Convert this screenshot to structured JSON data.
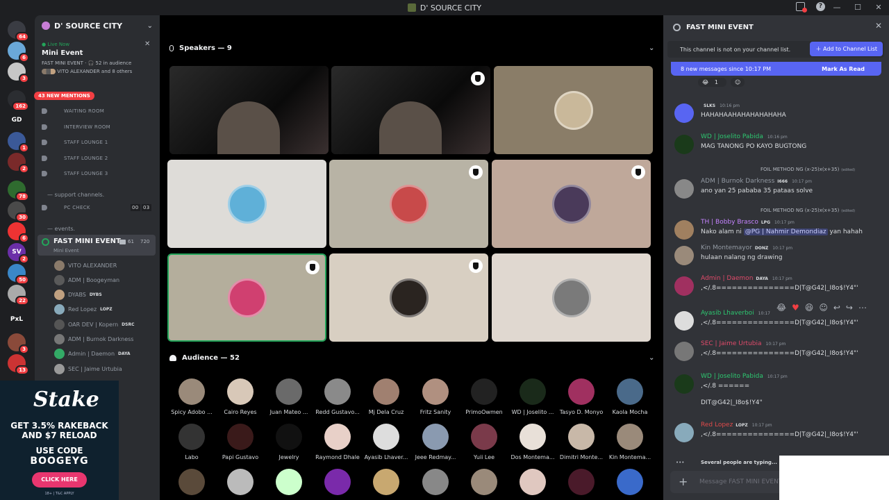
{
  "window": {
    "title": "D' SOURCE CITY"
  },
  "rail": {
    "servers": [
      {
        "label": "",
        "badge": "64",
        "color": "#3a3c43"
      },
      {
        "label": "",
        "badge": "6",
        "color": "#6aa8d8"
      },
      {
        "label": "",
        "badge": "3",
        "color": "#c7c7c7"
      },
      {
        "label": "",
        "badge": "162",
        "color": "#2b2d31"
      },
      {
        "label": "GD",
        "badge": "",
        "color": "#1e1f22"
      },
      {
        "label": "",
        "badge": "1",
        "color": "#3b5998"
      },
      {
        "label": "",
        "badge": "2",
        "color": "#7a2a2a"
      },
      {
        "label": "",
        "badge": "78",
        "color": "#2f6b2f"
      },
      {
        "label": "",
        "badge": "30",
        "color": "#4a4a4a"
      },
      {
        "label": "",
        "badge": "6",
        "color": "#e33"
      },
      {
        "label": "SV",
        "badge": "2",
        "color": "#6b2fa8"
      },
      {
        "label": "",
        "badge": "50",
        "color": "#3a87c8"
      },
      {
        "label": "",
        "badge": "22",
        "color": "#aaa"
      },
      {
        "label": "PxL",
        "badge": "",
        "color": "#1e1f22"
      },
      {
        "label": "",
        "badge": "3",
        "color": "#8a4a3a"
      },
      {
        "label": "",
        "badge": "13",
        "color": "#c33"
      }
    ]
  },
  "sidebar": {
    "guild_name": "D' SOURCE CITY",
    "live": {
      "tag": "Live Now",
      "title": "Mini Event",
      "meta": "FAST MINI EVENT · 🎧 52 in audience",
      "members": "VITO ALEXANDER and 8 others"
    },
    "mentions": "43 NEW MENTIONS",
    "channels": [
      {
        "name": "WAITING ROOM"
      },
      {
        "name": "INTERVIEW ROOM"
      },
      {
        "name": "STAFF LOUNGE 1"
      },
      {
        "name": "STAFF LOUNGE 2"
      },
      {
        "name": "STAFF LOUNGE 3"
      }
    ],
    "support_category": "— support channels.",
    "pc_check": {
      "name": "PC CHECK",
      "left": "00",
      "right": "03"
    },
    "events_category": "— events.",
    "active_channel": {
      "name": "FAST MINI EVENT",
      "sub": "Mini Event",
      "count_a": "61",
      "count_b": "720"
    },
    "members": [
      {
        "name": "VITO ALEXANDER",
        "tag": "",
        "color": "#8a7a6a"
      },
      {
        "name": "ADM | Boogeyman",
        "tag": "",
        "color": "#5a5a5a"
      },
      {
        "name": "DYABS",
        "tag": "DYBS",
        "color": "#c0a080"
      },
      {
        "name": "Red Lopez",
        "tag": "LOPZ",
        "color": "#8ab"
      },
      {
        "name": "OAR DEV | Kopern",
        "tag": "DSRC",
        "color": "#555"
      },
      {
        "name": "ADM | Burnok Darkness",
        "tag": "",
        "color": "#777"
      },
      {
        "name": "Admin | Daemon",
        "tag": "DAYA",
        "color": "#3a6"
      },
      {
        "name": "SEC | Jaime Urtubia",
        "tag": "",
        "color": "#999"
      }
    ]
  },
  "ad": {
    "brand": "Stake",
    "line1": "GET 3.5% RAKEBACK",
    "line2": "AND $7 RELOAD",
    "line3": "USE CODE",
    "code": "BOOGEYG",
    "button": "CLICK HERE",
    "terms": "18+ | T&C APPLY"
  },
  "stage": {
    "speakers_label": "Speakers — 9",
    "audience_label": "Audience — 52",
    "tiles": [
      {
        "bg": "#1a1a1a",
        "video": true,
        "avatar": "#444",
        "shield": false
      },
      {
        "bg": "#151515",
        "video": true,
        "avatar": "#333",
        "shield": true
      },
      {
        "bg": "#8a7d68",
        "video": false,
        "avatar": "#c9b89a",
        "shield": false
      },
      {
        "bg": "#dedcd8",
        "video": false,
        "avatar": "#5fb0d8",
        "shield": false
      },
      {
        "bg": "#b8b3a5",
        "video": false,
        "avatar": "#c84a4a",
        "shield": true
      },
      {
        "bg": "#bfa89a",
        "video": false,
        "avatar": "#4a3a5a",
        "shield": true
      },
      {
        "bg": "#b4ae9c",
        "video": false,
        "avatar": "#d04070",
        "shield": true
      },
      {
        "bg": "#d8cfc2",
        "video": false,
        "avatar": "#2a2420",
        "shield": true
      },
      {
        "bg": "#e0d8d0",
        "video": false,
        "avatar": "#7a7a7a",
        "shield": false
      }
    ],
    "audience": [
      {
        "name": "Spicy Adobo ...",
        "color": "#9a8a7a"
      },
      {
        "name": "Cairo Reyes",
        "color": "#d8c8b8"
      },
      {
        "name": "Juan Mateo ...",
        "color": "#6a6a6a"
      },
      {
        "name": "Redd Gustavo...",
        "color": "#8a8a8a"
      },
      {
        "name": "Mj Dela Cruz",
        "color": "#a08070"
      },
      {
        "name": "Fritz Sanity",
        "color": "#b09080"
      },
      {
        "name": "PrimoOwmen",
        "color": "#222"
      },
      {
        "name": "WD | Joselito ...",
        "color": "#1a2a1a"
      },
      {
        "name": "Tasyo D. Monyo",
        "color": "#a03060"
      },
      {
        "name": "Kaola Mocha",
        "color": "#4a6a8a"
      },
      {
        "name": "Labo",
        "color": "#333"
      },
      {
        "name": "Papi Gustavo",
        "color": "#3a1a1a"
      },
      {
        "name": "Jewelry",
        "color": "#111"
      },
      {
        "name": "Raymond Dhale",
        "color": "#e8d0c8"
      },
      {
        "name": "Ayasib Lhaver...",
        "color": "#ddd"
      },
      {
        "name": "Jeee Redmay...",
        "color": "#8a9ab0"
      },
      {
        "name": "Yuii Lee",
        "color": "#7a3a4a"
      },
      {
        "name": "Dos Montema...",
        "color": "#e8e0d8"
      },
      {
        "name": "Dimitri Monte...",
        "color": "#c8b8a8"
      },
      {
        "name": "Kin Montema...",
        "color": "#9a8a7a"
      }
    ],
    "row3": [
      "#5a4a3a",
      "#bbb",
      "#cfc",
      "#7a2aaa",
      "#c8a870",
      "#888",
      "#9a8a7a",
      "#e0c8c0",
      "#4a1a2a",
      "#3a6aca"
    ]
  },
  "chat": {
    "title": "FAST MINI EVENT",
    "notice": "This channel is not on your channel list.",
    "add_button": "Add to Channel List",
    "new_messages": "8 new messages since 10:17 PM",
    "mark_read": "Mark As Read",
    "reaction_count": "1",
    "messages": [
      {
        "name": "",
        "tag": "SLKS",
        "time": "10:16 pm",
        "text": "HAHAHAAHAHAHAHAHAHA",
        "color": "#5865f2",
        "nameColor": "#dbdee1"
      },
      {
        "name": "WD | Joselito Pabida",
        "tag": "",
        "time": "10:16 pm",
        "text": "MAG TANONG PO KAYO BUGTONG",
        "color": "#1a3a1a",
        "nameColor": "#2dc770"
      },
      {
        "reply": "FOIL METHOD NG (x-25)x(x+35)",
        "edited": "(edited)",
        "name": "ADM | Burnok Darkness",
        "tag": "I666",
        "time": "10:17 pm",
        "text": "ano yan  25 pababa 35 pataas solve",
        "color": "#888",
        "nameColor": "#949ba4"
      },
      {
        "reply": "FOIL METHOD NG (x-25)x(x+35)",
        "edited": "(edited)",
        "name": "TH | Bobby Brasco",
        "tag": "LPG",
        "time": "10:17 pm",
        "text_pre": "Nako alam ni ",
        "mention": "@PG | Nahmir Demondiaz",
        "text_post": " yan hahah",
        "color": "#a08060",
        "nameColor": "#c583ff"
      },
      {
        "name": "Kin Montemayor",
        "tag": "DONZ",
        "time": "10:17 pm",
        "text": "hulaan nalang ng drawing",
        "color": "#9a8a7a",
        "nameColor": "#949ba4"
      },
      {
        "name": "Admin | Daemon",
        "tag": "DAYA",
        "time": "10:17 pm",
        "text": ",</.8===============D|T@G42|_I8o$!Y4\"'",
        "color": "#a03060",
        "nameColor": "#e04a6a"
      },
      {
        "name": "Ayasib Lhaverboi",
        "tag": "",
        "time": "10:17",
        "text": ",</.8===============D|T@G42|_I8o$!Y4\"'",
        "color": "#ddd",
        "nameColor": "#2dc770"
      },
      {
        "name": "SEC | Jaime Urtubia",
        "tag": "",
        "time": "10:17 pm",
        "text": ",</.8===============D|T@G42|_I8o$!Y4\"'",
        "color": "#777",
        "nameColor": "#e04a6a"
      },
      {
        "name": "WD | Joselito Pabida",
        "tag": "",
        "time": "10:17 pm",
        "text": ",</.8 ======",
        "text2": "DIT@G42|_I8o$!Y4\"",
        "color": "#1a3a1a",
        "nameColor": "#2dc770"
      },
      {
        "name": "Red Lopez",
        "tag": "LOPZ",
        "time": "10:17 pm",
        "text": ",</.8===============D|T@G42|_I8o$!Y4\"'",
        "color": "#8ab",
        "nameColor": "#e04a4a"
      }
    ],
    "typing": "Several people are typing...",
    "input_placeholder": "Message FAST MINI EVENT"
  }
}
